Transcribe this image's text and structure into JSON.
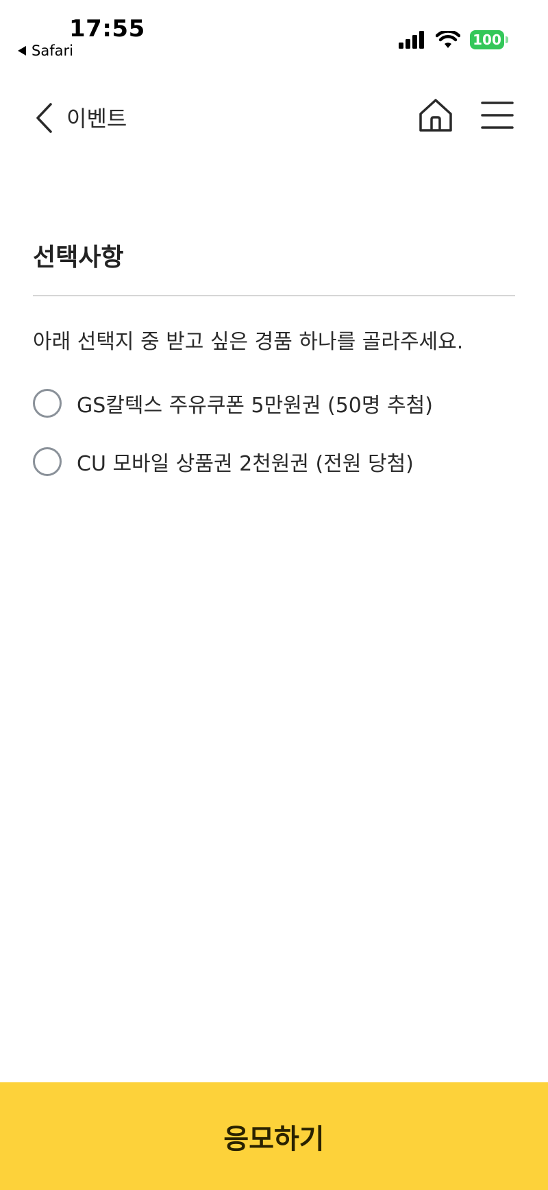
{
  "status_bar": {
    "time": "17:55",
    "back_app": "Safari",
    "battery": "100"
  },
  "nav": {
    "title": "이벤트"
  },
  "section": {
    "title": "선택사항",
    "instruction": "아래 선택지 중 받고 싶은 경품 하나를 골라주세요."
  },
  "options": [
    {
      "label": "GS칼텍스 주유쿠폰 5만원권 (50명 추첨)",
      "selected": false
    },
    {
      "label": "CU 모바일 상품권 2천원권 (전원 당첨)",
      "selected": false
    }
  ],
  "cta": {
    "label": "응모하기"
  },
  "colors": {
    "cta_background": "#fdd23a",
    "battery_green": "#33c759",
    "radio_border": "#8a9199"
  }
}
